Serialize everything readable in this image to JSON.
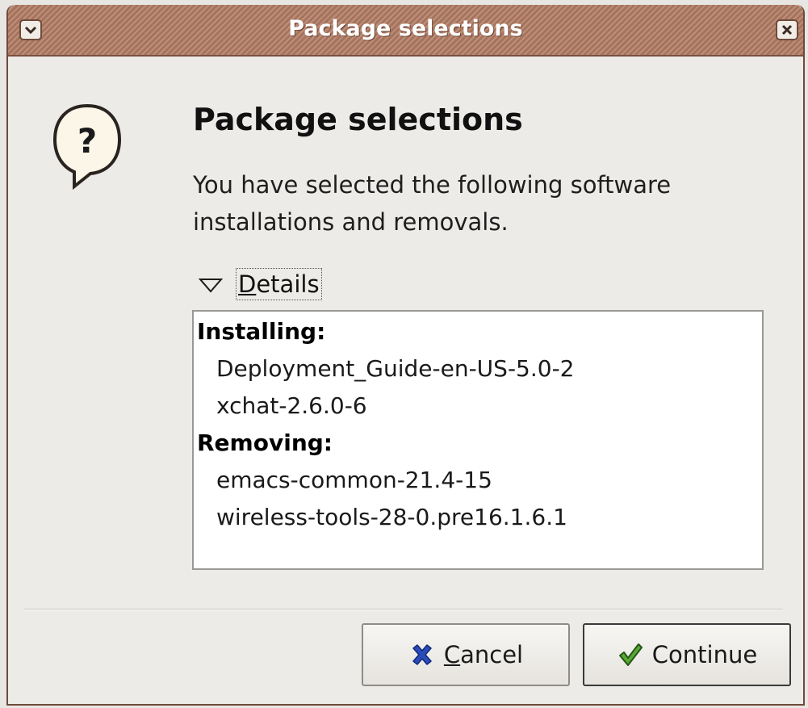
{
  "window": {
    "title": "Package selections"
  },
  "dialog": {
    "icon": "question-icon",
    "heading": "Package selections",
    "message": "You have selected the following software installations and removals.",
    "expander": {
      "expanded": true,
      "mnemonic": "D",
      "label_rest": "etails"
    },
    "details": {
      "installing_label": "Installing:",
      "installing": [
        "Deployment_Guide-en-US-5.0-2",
        "xchat-2.6.0-6"
      ],
      "removing_label": "Removing:",
      "removing": [
        "emacs-common-21.4-15",
        "wireless-tools-28-0.pre16.1.6.1"
      ]
    }
  },
  "buttons": {
    "cancel": {
      "mnemonic": "C",
      "label_rest": "ancel",
      "icon": "cancel-x-icon"
    },
    "continue": {
      "label": "Continue",
      "icon": "checkmark-icon"
    }
  },
  "colors": {
    "titlebar": "#b07a62",
    "window_bg": "#edebe7",
    "details_bg": "#ffffff",
    "cancel_icon": "#2a4bb8",
    "continue_icon": "#5aa832"
  }
}
